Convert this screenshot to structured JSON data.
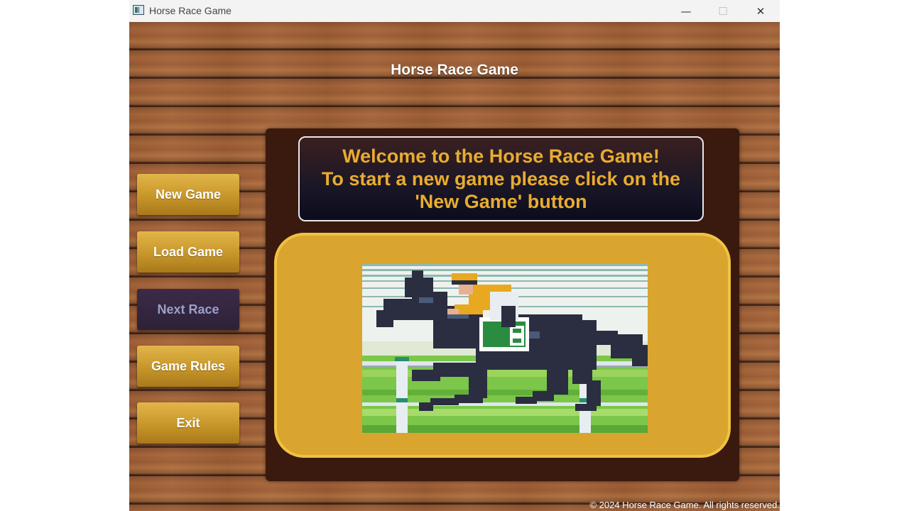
{
  "window": {
    "title": "Horse Race Game",
    "controls": {
      "minimize": "—",
      "maximize": "☐",
      "close": "✕"
    }
  },
  "header": {
    "title": "Horse Race Game"
  },
  "sidebar": {
    "items": [
      {
        "label": "New Game",
        "enabled": true
      },
      {
        "label": "Load Game",
        "enabled": true
      },
      {
        "label": "Next Race",
        "enabled": false
      },
      {
        "label": "Game Rules",
        "enabled": true
      },
      {
        "label": "Exit",
        "enabled": true
      }
    ]
  },
  "main": {
    "welcome_lines": [
      "Welcome to the Horse Race Game!",
      "To start a new game please click on the",
      "'New Game' button"
    ],
    "image": {
      "subject": "pixel-art racehorse with jockey",
      "saddle_number": "8"
    }
  },
  "footer": {
    "copyright": "© 2024 Horse Race Game. All rights reserved."
  },
  "colors": {
    "button_gold": "#c7962a",
    "button_disabled": "#2d2238",
    "welcome_text": "#e8ac30",
    "frame_gold": "#d9a52e",
    "panel_dark": "#3a1a0e"
  }
}
